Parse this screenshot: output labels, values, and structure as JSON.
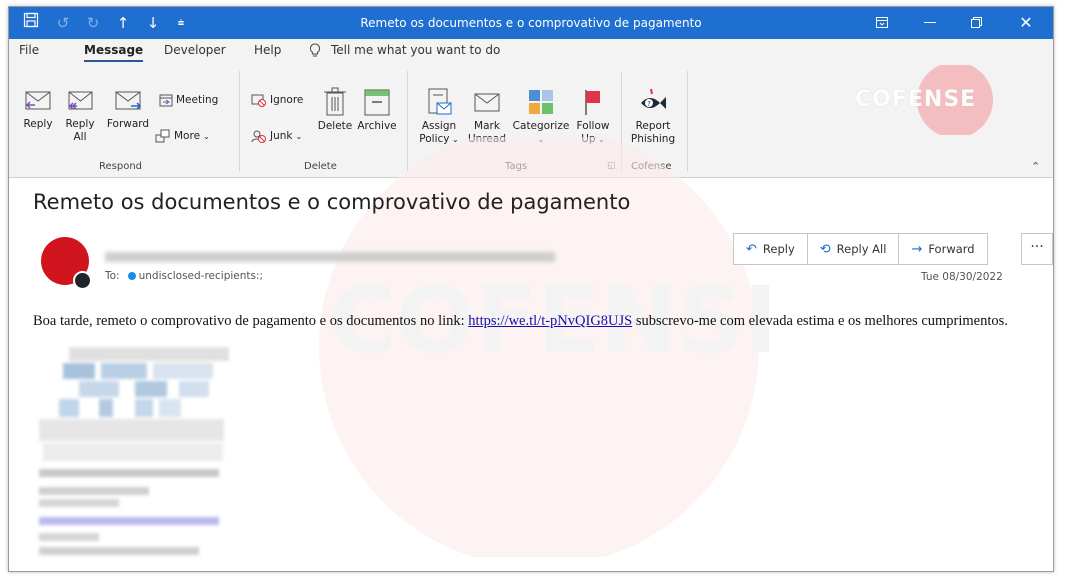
{
  "window": {
    "title": "Remeto os documentos e o comprovativo de pagamento",
    "quick_access": {
      "save_icon": "save-icon",
      "undo_icon": "undo-icon",
      "redo_icon": "redo-icon",
      "up_icon": "up-arrow-icon",
      "down_icon": "down-arrow-icon",
      "customize_icon": "customize-icon"
    }
  },
  "menu": {
    "tabs": [
      "File",
      "Message",
      "Developer",
      "Help"
    ],
    "active_tab": "Message",
    "tell_me": "Tell me what you want to do"
  },
  "ribbon": {
    "respond": {
      "group_label": "Respond",
      "reply": "Reply",
      "reply_all_1": "Reply",
      "reply_all_2": "All",
      "forward": "Forward",
      "meeting": "Meeting",
      "more": "More"
    },
    "delete": {
      "group_label": "Delete",
      "ignore": "Ignore",
      "junk": "Junk",
      "delete": "Delete",
      "archive": "Archive"
    },
    "tags": {
      "group_label": "Tags",
      "assign_1": "Assign",
      "assign_2": "Policy",
      "mark_1": "Mark",
      "mark_2": "Unread",
      "categorize": "Categorize",
      "follow_1": "Follow",
      "follow_2": "Up"
    },
    "cofense": {
      "group_label": "Cofense",
      "report_1": "Report",
      "report_2": "Phishing"
    },
    "logo_text": "COFENSE"
  },
  "message": {
    "subject": "Remeto os documentos e o comprovativo de pagamento",
    "to_label": "To:",
    "recipients": "undisclosed-recipients:;",
    "date": "Tue 08/30/2022",
    "actions": {
      "reply": "Reply",
      "reply_all": "Reply All",
      "forward": "Forward",
      "more": "···"
    },
    "body_before_link": "Boa tarde, remeto o comprovativo de pagamento e os documentos no link: ",
    "link": "https://we.tl/t-pNvQIG8UJS",
    "body_after_link": "  subscrevo-me com elevada estima e os melhores cumprimentos."
  },
  "colors": {
    "title_bar": "#1e6fd0",
    "avatar": "#d0151f",
    "link": "#1a0dab",
    "accent": "#1b6ac9"
  }
}
